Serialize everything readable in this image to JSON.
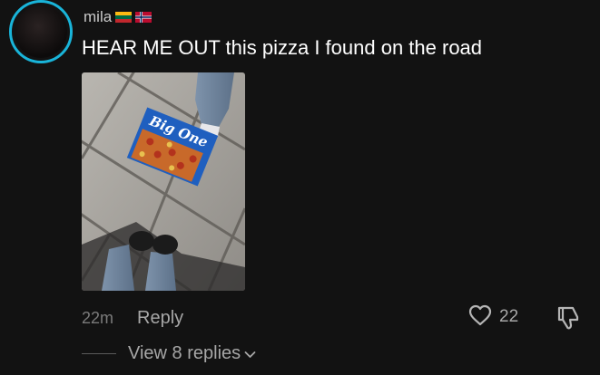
{
  "comment": {
    "username": "mila",
    "flags": [
      "lithuania-flag",
      "norway-flag"
    ],
    "text": "HEAR ME OUT this pizza I found on the road",
    "avatar_ring_color": "#19b4d9",
    "photo": {
      "box_brand_text": "Big One"
    },
    "timestamp": "22m",
    "reply_label": "Reply",
    "like_count": "22",
    "view_replies_label": "View 8 replies"
  },
  "icons": {
    "like": "heart-icon",
    "dislike": "thumbs-down-icon",
    "expand": "chevron-down-icon"
  },
  "colors": {
    "background": "#121212",
    "text_primary": "#ffffff",
    "text_secondary": "#a7a7a7",
    "text_muted": "#7b7b7b"
  }
}
